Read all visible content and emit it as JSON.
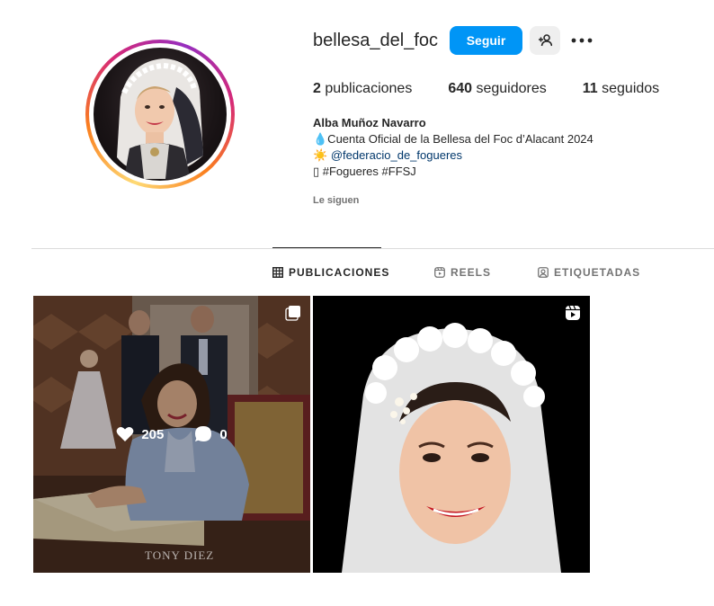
{
  "profile": {
    "username": "bellesa_del_foc",
    "follow_label": "Seguir",
    "stats": {
      "posts_count": "2",
      "posts_label": "publicaciones",
      "followers_count": "640",
      "followers_label": "seguidores",
      "following_count": "11",
      "following_label": "seguidos"
    },
    "bio": {
      "name": "Alba Muñoz Navarro",
      "line1": "💧Cuenta Oficial de la Bellesa del Foc d’Alacant 2024",
      "line2_prefix": "☀️ ",
      "line2_mention": "@federacio_de_fogueres",
      "line3": "▯ #Fogueres #FFSJ"
    },
    "followed_by_label": "Le siguen"
  },
  "tabs": [
    {
      "label": "PUBLICACIONES",
      "icon": "grid-icon",
      "active": true
    },
    {
      "label": "REELS",
      "icon": "reels-icon",
      "active": false
    },
    {
      "label": "ETIQUETADAS",
      "icon": "tagged-icon",
      "active": false
    }
  ],
  "posts": [
    {
      "likes": "205",
      "comments": "0",
      "type_icon": "carousel-icon",
      "watermark": "TONY DIEZ"
    },
    {
      "type_icon": "reel-icon"
    }
  ],
  "colors": {
    "accent": "#0095f6",
    "text": "#262626",
    "muted": "#737373",
    "divider": "#dbdbdb"
  }
}
